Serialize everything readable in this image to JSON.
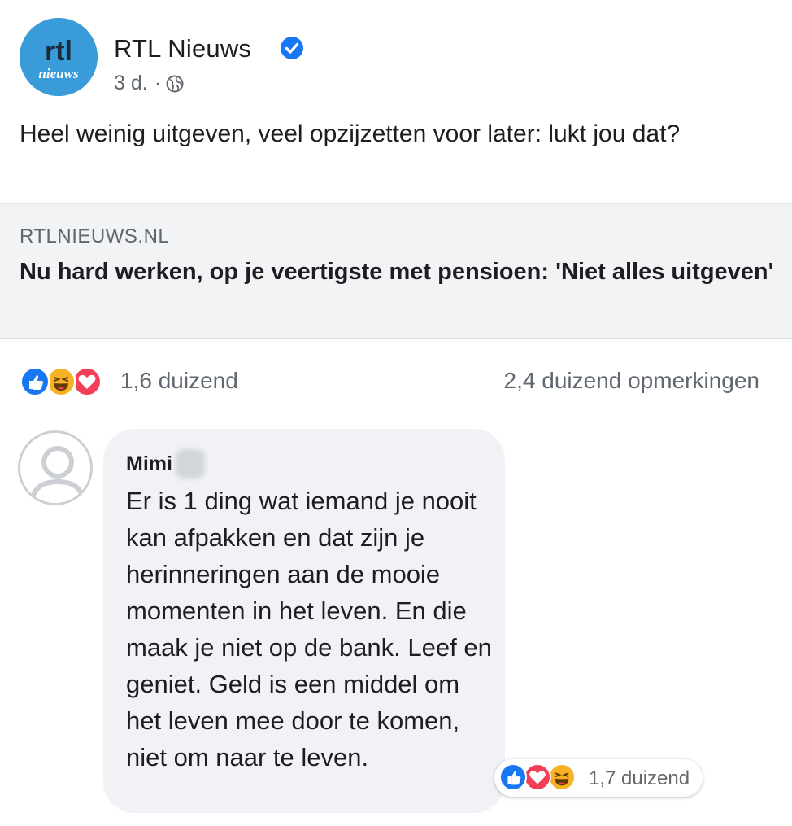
{
  "post": {
    "page_name": "RTL Nieuws",
    "logo_text_top": "rtl",
    "logo_text_bottom": "nieuws",
    "time": "3 d.",
    "separator": "·",
    "text": "Heel weinig uitgeven, veel opzijzetten voor later: lukt jou dat?",
    "verified_icon": "verified-check-icon",
    "privacy_icon": "globe-icon"
  },
  "link": {
    "domain": "RTLNIEUWS.NL",
    "title": "Nu hard werken, op je veertigste met pensioen: 'Niet alles uitgeven'"
  },
  "reactions": {
    "icons": [
      "like-icon",
      "haha-icon",
      "love-icon"
    ],
    "count": "1,6 duizend",
    "comments": "2,4 duizend opmerkingen"
  },
  "comment": {
    "author": "Mimi",
    "text": "Er is 1 ding wat iemand je nooit kan afpakken en dat zijn je herinneringen aan de mooie momenten in het leven. En die maak je niet op de bank. Leef en geniet. Geld is een middel om het leven mee door te komen, niet om naar te leven.",
    "reaction_icons": [
      "like-icon",
      "love-icon",
      "haha-icon"
    ],
    "reaction_count": "1,7 duizend"
  },
  "colors": {
    "facebook_blue": "#1877f2",
    "love_red": "#f33e58",
    "haha_yellow": "#f7b125",
    "logo_blue": "#3a9bd9",
    "muted_text": "#606770",
    "bubble_bg": "#f0f2f5"
  }
}
